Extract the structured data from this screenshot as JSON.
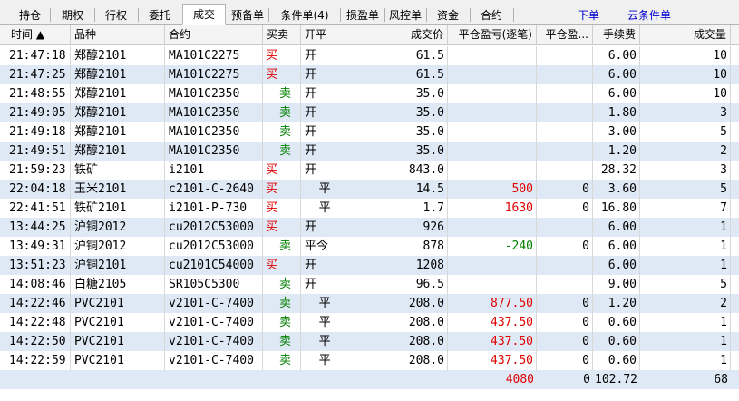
{
  "tabs": [
    "持仓",
    "期权",
    "行权",
    "委托",
    "成交",
    "预备单",
    "条件单(4)",
    "损盈单",
    "风控单",
    "资金",
    "合约"
  ],
  "active_tab": "成交",
  "links": {
    "order": "下单",
    "cloud_condition": "云条件单"
  },
  "columns": [
    "时间 ▲",
    "品种",
    "合约",
    "买卖",
    "开平",
    "成交价",
    "平仓盈亏(逐笔)",
    "平仓盈...",
    "手续费",
    "成交量"
  ],
  "rows": [
    {
      "time": "21:47:18",
      "product": "郑醇2101",
      "contract": "MA101C2275",
      "side": "买",
      "side_color": "red",
      "oc": "开",
      "price": "61.5",
      "pnl": "",
      "pnl_color": "",
      "pnl2": "",
      "fee": "6.00",
      "qty": "10"
    },
    {
      "time": "21:47:25",
      "product": "郑醇2101",
      "contract": "MA101C2275",
      "side": "买",
      "side_color": "red",
      "oc": "开",
      "price": "61.5",
      "pnl": "",
      "pnl_color": "",
      "pnl2": "",
      "fee": "6.00",
      "qty": "10"
    },
    {
      "time": "21:48:55",
      "product": "郑醇2101",
      "contract": "MA101C2350",
      "side": "卖",
      "side_color": "green",
      "oc": "开",
      "price": "35.0",
      "pnl": "",
      "pnl_color": "",
      "pnl2": "",
      "fee": "6.00",
      "qty": "10"
    },
    {
      "time": "21:49:05",
      "product": "郑醇2101",
      "contract": "MA101C2350",
      "side": "卖",
      "side_color": "green",
      "oc": "开",
      "price": "35.0",
      "pnl": "",
      "pnl_color": "",
      "pnl2": "",
      "fee": "1.80",
      "qty": "3"
    },
    {
      "time": "21:49:18",
      "product": "郑醇2101",
      "contract": "MA101C2350",
      "side": "卖",
      "side_color": "green",
      "oc": "开",
      "price": "35.0",
      "pnl": "",
      "pnl_color": "",
      "pnl2": "",
      "fee": "3.00",
      "qty": "5"
    },
    {
      "time": "21:49:51",
      "product": "郑醇2101",
      "contract": "MA101C2350",
      "side": "卖",
      "side_color": "green",
      "oc": "开",
      "price": "35.0",
      "pnl": "",
      "pnl_color": "",
      "pnl2": "",
      "fee": "1.20",
      "qty": "2"
    },
    {
      "time": "21:59:23",
      "product": "铁矿",
      "contract": "i2101",
      "side": "买",
      "side_color": "red",
      "oc": "开",
      "price": "843.0",
      "pnl": "",
      "pnl_color": "",
      "pnl2": "",
      "fee": "28.32",
      "qty": "3"
    },
    {
      "time": "22:04:18",
      "product": "玉米2101",
      "contract": "c2101-C-2640",
      "side": "买",
      "side_color": "red",
      "oc": "  平",
      "price": "14.5",
      "pnl": "500",
      "pnl_color": "red",
      "pnl2": "0",
      "fee": "3.60",
      "qty": "5"
    },
    {
      "time": "22:41:51",
      "product": "铁矿2101",
      "contract": "i2101-P-730",
      "side": "买",
      "side_color": "red",
      "oc": "  平",
      "price": "1.7",
      "pnl": "1630",
      "pnl_color": "red",
      "pnl2": "0",
      "fee": "16.80",
      "qty": "7"
    },
    {
      "time": "13:44:25",
      "product": "沪铜2012",
      "contract": "cu2012C53000",
      "side": "买",
      "side_color": "red",
      "oc": "开",
      "price": "926",
      "pnl": "",
      "pnl_color": "",
      "pnl2": "",
      "fee": "6.00",
      "qty": "1"
    },
    {
      "time": "13:49:31",
      "product": "沪铜2012",
      "contract": "cu2012C53000",
      "side": "卖",
      "side_color": "green",
      "oc": "平今",
      "price": "878",
      "pnl": "-240",
      "pnl_color": "green",
      "pnl2": "0",
      "fee": "6.00",
      "qty": "1"
    },
    {
      "time": "13:51:23",
      "product": "沪铜2101",
      "contract": "cu2101C54000",
      "side": "买",
      "side_color": "red",
      "oc": "开",
      "price": "1208",
      "pnl": "",
      "pnl_color": "",
      "pnl2": "",
      "fee": "6.00",
      "qty": "1"
    },
    {
      "time": "14:08:46",
      "product": "白糖2105",
      "contract": "SR105C5300",
      "side": "卖",
      "side_color": "green",
      "oc": "开",
      "price": "96.5",
      "pnl": "",
      "pnl_color": "",
      "pnl2": "",
      "fee": "9.00",
      "qty": "5"
    },
    {
      "time": "14:22:46",
      "product": "PVC2101",
      "contract": "v2101-C-7400",
      "side": "卖",
      "side_color": "green",
      "oc": "  平",
      "price": "208.0",
      "pnl": "877.50",
      "pnl_color": "red",
      "pnl2": "0",
      "fee": "1.20",
      "qty": "2"
    },
    {
      "time": "14:22:48",
      "product": "PVC2101",
      "contract": "v2101-C-7400",
      "side": "卖",
      "side_color": "green",
      "oc": "  平",
      "price": "208.0",
      "pnl": "437.50",
      "pnl_color": "red",
      "pnl2": "0",
      "fee": "0.60",
      "qty": "1"
    },
    {
      "time": "14:22:50",
      "product": "PVC2101",
      "contract": "v2101-C-7400",
      "side": "卖",
      "side_color": "green",
      "oc": "  平",
      "price": "208.0",
      "pnl": "437.50",
      "pnl_color": "red",
      "pnl2": "0",
      "fee": "0.60",
      "qty": "1"
    },
    {
      "time": "14:22:59",
      "product": "PVC2101",
      "contract": "v2101-C-7400",
      "side": "卖",
      "side_color": "green",
      "oc": "  平",
      "price": "208.0",
      "pnl": "437.50",
      "pnl_color": "red",
      "pnl2": "0",
      "fee": "0.60",
      "qty": "1"
    }
  ],
  "summary": {
    "pnl": "4080",
    "pnl2": "0",
    "fee": "102.72",
    "qty": "68"
  },
  "colors": {
    "red": "#e00000",
    "green": "#008000",
    "alt_row": "#dfe9f5",
    "link": "#0000cc"
  }
}
